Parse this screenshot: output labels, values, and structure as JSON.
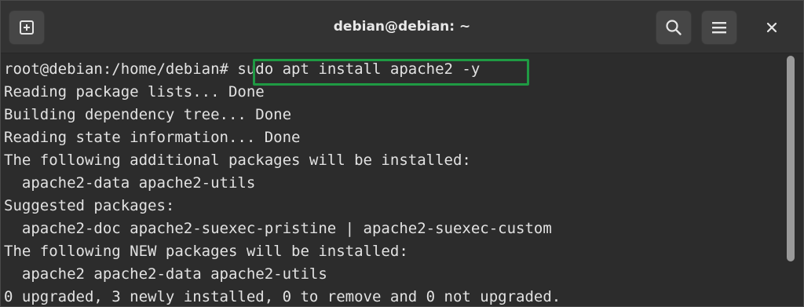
{
  "window": {
    "title": "debian@debian: ~"
  },
  "header": {
    "new_tab_icon": "new-tab-plus-icon",
    "search_icon": "search-icon",
    "menu_icon": "hamburger-menu-icon",
    "close_icon": "close-icon"
  },
  "terminal": {
    "prompt": "root@debian:/home/debian#",
    "command": " sudo apt install apache2 -y",
    "output": [
      "Reading package lists... Done",
      "Building dependency tree... Done",
      "Reading state information... Done",
      "The following additional packages will be installed:",
      "  apache2-data apache2-utils",
      "Suggested packages:",
      "  apache2-doc apache2-suexec-pristine | apache2-suexec-custom",
      "The following NEW packages will be installed:",
      "  apache2 apache2-data apache2-utils",
      "0 upgraded, 3 newly installed, 0 to remove and 0 not upgraded."
    ]
  },
  "colors": {
    "highlight": "#1f9a43",
    "text": "#e2e2e2",
    "background": "#2c2c2c",
    "headerbar": "#333333"
  }
}
